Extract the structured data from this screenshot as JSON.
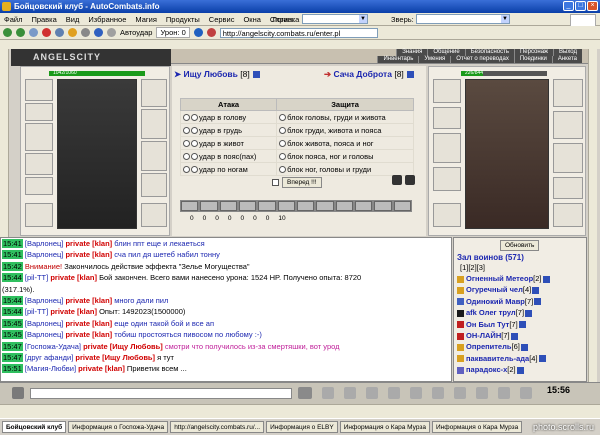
{
  "window": {
    "title": "Бойцовский клуб - AutoCombats.info"
  },
  "menu": [
    "Файл",
    "Правка",
    "Вид",
    "Избранное",
    "Магия",
    "Продукты",
    "Сервис",
    "Окна",
    "Справка"
  ],
  "login": {
    "label": "Логин:",
    "value": ""
  },
  "beast": {
    "label": "Зверь:",
    "value": ""
  },
  "toolbar": {
    "autoudar": "Автоудар",
    "uron": "Урон: 0"
  },
  "address": {
    "url": "http://angelscity.combats.ru/enter.pl"
  },
  "nav": [
    "Знания",
    "Общение",
    "Безопасность",
    "Персонаж",
    "Выход"
  ],
  "nav2": [
    "Инвентарь",
    "Умения",
    "Отчет о переводах",
    "Поединки",
    "Анкета"
  ],
  "game": {
    "logo": "ANGELSCITY"
  },
  "player1": {
    "name": "Ищу Любовь",
    "level": "[8]",
    "hp": "1042/1060"
  },
  "player2": {
    "name": "Сача Доброта",
    "level": "[8]",
    "hp": "226/844"
  },
  "attack_header": "Атака",
  "defense_header": "Защита",
  "attack_options": [
    "удар в голову",
    "удар в грудь",
    "удар в живот",
    "удар в пояс(пах)",
    "удар по ногам"
  ],
  "defense_options": [
    "блок головы, груди и живота",
    "блок груди, живота и пояса",
    "блок живота, пояса и ног",
    "блок пояса, ног и головы",
    "блок ног, головы и груди"
  ],
  "forward_button": "Вперед !!!",
  "battle_stats": [
    "0",
    "0",
    "0",
    "0",
    "0",
    "0",
    "0",
    "10"
  ],
  "chat": [
    {
      "time": "15:41",
      "name": "[Варлонец]",
      "priv": "private [klan]",
      "msg": "блин ппт еще и лекаеться",
      "cls": "ms"
    },
    {
      "time": "15:41",
      "name": "[Варлонец]",
      "priv": "private [klan]",
      "msg": "сча пил дя шетеб набил тонну",
      "cls": "ms"
    },
    {
      "time": "15:42",
      "name": "Внимание!",
      "priv": "",
      "msg": "Закончилось действие эффекта \"Зелье Могущества\"",
      "cls": "plain"
    },
    {
      "time": "15:44",
      "name": "[pil-TT]",
      "priv": "private [klan]",
      "msg": "Бой закончен. Всего вами нанесено урона: 1524 HP. Получено опыта: 8720",
      "cls": "plain"
    },
    {
      "time": "",
      "name": "",
      "priv": "",
      "msg": "(317.1%).",
      "cls": "plain"
    },
    {
      "time": "15:44",
      "name": "[Варлонец]",
      "priv": "private [klan]",
      "msg": "много дали пил",
      "cls": "ms"
    },
    {
      "time": "15:44",
      "name": "[pil-TT]",
      "priv": "private [klan]",
      "msg": "Опыт: 1492023(1500000)",
      "cls": "plain"
    },
    {
      "time": "15:45",
      "name": "[Варлонец]",
      "priv": "private [klan]",
      "msg": "еще один такой бой и все ап",
      "cls": "ms"
    },
    {
      "time": "15:45",
      "name": "[Варлонец]",
      "priv": "private [klan]",
      "msg": "тобиш простояться пивосом по любому :-)",
      "cls": "ms"
    },
    {
      "time": "15:47",
      "name": "[Госпожа-Удача]",
      "priv": "private [Ищу Любовь]",
      "msg": "смотри что получилось из-за смертяшки, вот урод",
      "cls": "pink"
    },
    {
      "time": "15:47",
      "name": "[друг афанди]",
      "priv": "private [Ищу Любовь]",
      "msg": "я тут",
      "cls": "plain"
    },
    {
      "time": "15:51",
      "name": "[Магия-Любви]",
      "priv": "private [klan]",
      "msg": "Приветик всем ...",
      "cls": "plain"
    }
  ],
  "online": {
    "refresh_button": "Обновить",
    "title": "Зал воинов (571)",
    "pages": "[1][2][3]",
    "users": [
      {
        "name": "Огненный Метеор",
        "lvl": "[2]",
        "icon": "#d8a020"
      },
      {
        "name": "Огуречный чел",
        "lvl": "[4]",
        "icon": "#d8a020"
      },
      {
        "name": "Одинокий Мавр",
        "lvl": "[7]",
        "icon": "#4060c0"
      },
      {
        "name": "afk Олег трул",
        "lvl": "[7]",
        "icon": "#1a1a1a"
      },
      {
        "name": "Он Был Тут",
        "lvl": "[7]",
        "icon": "#c02020"
      },
      {
        "name": "ОН-ЛАЙН",
        "lvl": "[7]",
        "icon": "#c02020"
      },
      {
        "name": "Опрепитель",
        "lvl": "[6]",
        "icon": "#d8a020"
      },
      {
        "name": "паквавитель-ада",
        "lvl": "[4]",
        "icon": "#d8a020"
      },
      {
        "name": "парадокс-x",
        "lvl": "[2]",
        "icon": "#6060c0"
      }
    ]
  },
  "clock": "15:56",
  "taskbar": [
    "Бойцовский клуб",
    "Информация о Госпожа-Удача",
    "http://angelscity.combats.ru/...",
    "Информация о ELBY",
    "Информация о Кара Мурза",
    "Информация о Кара Мурза"
  ],
  "watermark": "photo.scrolls.ru"
}
